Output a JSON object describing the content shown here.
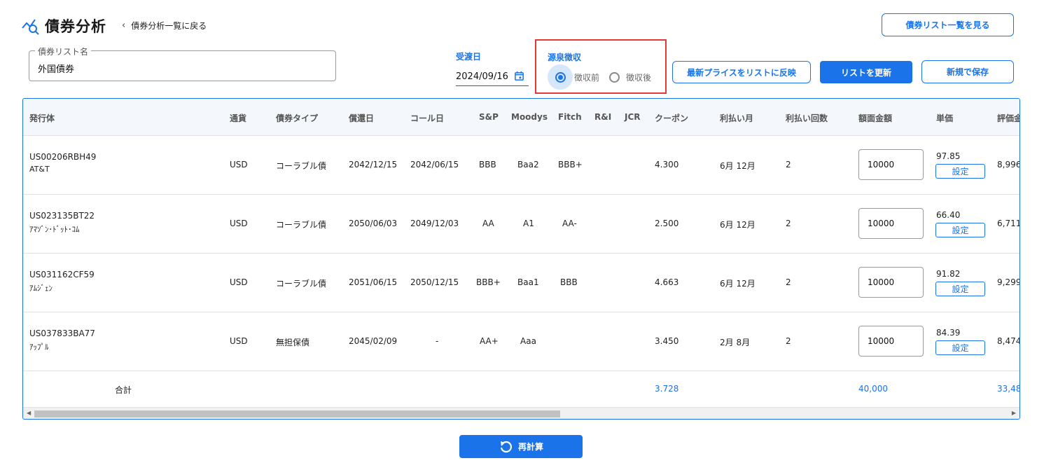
{
  "header": {
    "title": "債券分析",
    "back_label": "債券分析一覧に戻る",
    "list_button": "債券リスト一覧を見る"
  },
  "form": {
    "list_name_label": "債券リスト名",
    "list_name_value": "外国債券",
    "date_label": "受渡日",
    "date_value": "2024/09/16",
    "withholding_label": "源泉徴収",
    "withholding_options": [
      "徴収前",
      "徴収後"
    ],
    "withholding_selected": "徴収前",
    "reflect_button": "最新プライスをリストに反映",
    "update_button": "リストを更新",
    "save_button": "新規で保存"
  },
  "table": {
    "columns": [
      "発行体",
      "通貨",
      "債券タイプ",
      "償還日",
      "コール日",
      "S&P",
      "Moodys",
      "Fitch",
      "R&I",
      "JCR",
      "クーポン",
      "利払い月",
      "利払い回数",
      "額面金額",
      "単価",
      "評価金"
    ],
    "rows": [
      {
        "code": "US00206RBH49",
        "name": "AT&T",
        "currency": "USD",
        "type": "コーラブル債",
        "maturity": "2042/12/15",
        "call": "2042/06/15",
        "sp": "BBB",
        "moodys": "Baa2",
        "fitch": "BBB+",
        "ri": "",
        "jcr": "",
        "coupon": "4.300",
        "months": "6月 12月",
        "count": "2",
        "face": "10000",
        "price": "97.85",
        "set": "設定",
        "value": "8,996"
      },
      {
        "code": "US023135BT22",
        "name": "ｱﾏｿﾞﾝ･ﾄﾞｯﾄ･ｺﾑ",
        "currency": "USD",
        "type": "コーラブル債",
        "maturity": "2050/06/03",
        "call": "2049/12/03",
        "sp": "AA",
        "moodys": "A1",
        "fitch": "AA-",
        "ri": "",
        "jcr": "",
        "coupon": "2.500",
        "months": "6月 12月",
        "count": "2",
        "face": "10000",
        "price": "66.40",
        "set": "設定",
        "value": "6,711"
      },
      {
        "code": "US031162CF59",
        "name": "ｱﾑｼﾞｪﾝ",
        "currency": "USD",
        "type": "コーラブル債",
        "maturity": "2051/06/15",
        "call": "2050/12/15",
        "sp": "BBB+",
        "moodys": "Baa1",
        "fitch": "BBB",
        "ri": "",
        "jcr": "",
        "coupon": "4.663",
        "months": "6月 12月",
        "count": "2",
        "face": "10000",
        "price": "91.82",
        "set": "設定",
        "value": "9,299"
      },
      {
        "code": "US037833BA77",
        "name": "ｱｯﾌﾟﾙ",
        "currency": "USD",
        "type": "無担保債",
        "maturity": "2045/02/09",
        "call": "-",
        "sp": "AA+",
        "moodys": "Aaa",
        "fitch": "",
        "ri": "",
        "jcr": "",
        "coupon": "3.450",
        "months": "2月 8月",
        "count": "2",
        "face": "10000",
        "price": "84.39",
        "set": "設定",
        "value": "8,474"
      }
    ],
    "total": {
      "label": "合計",
      "coupon": "3.728",
      "face": "40,000",
      "value": "33,48"
    }
  },
  "footer": {
    "recalc_label": "再計算"
  },
  "colors": {
    "accent": "#1a73e8",
    "highlight_border": "#e53935"
  }
}
